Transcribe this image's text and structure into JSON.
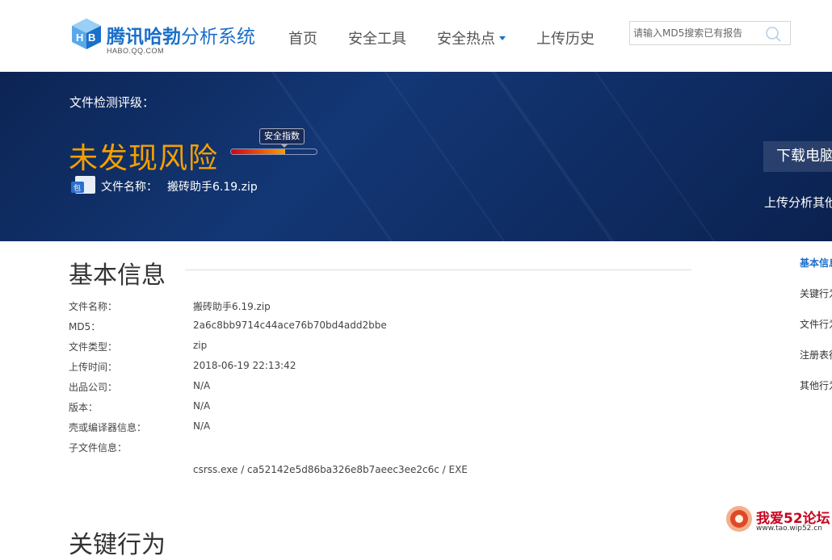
{
  "header": {
    "logo_title_strong": "腾讯哈勃",
    "logo_title_rest": "分析系统",
    "logo_sub": "HABO.QQ.COM",
    "nav": [
      {
        "label": "首页"
      },
      {
        "label": "安全工具"
      },
      {
        "label": "安全热点",
        "has_dropdown": true
      },
      {
        "label": "上传历史"
      }
    ],
    "search_placeholder": "请输入MD5搜索已有报告",
    "search_icon": "search-icon"
  },
  "banner": {
    "rating_label": "文件检测评级：",
    "risk_text": "未发现风险",
    "index_badge": "安全指数",
    "meter_fraction": 0.63,
    "file_icon_text": "包",
    "file_name_label": "文件名称：",
    "file_name": "搬砖助手6.19.zip",
    "download_button": "下载电脑",
    "upload_other": "上传分析其他"
  },
  "basic_info": {
    "title": "基本信息",
    "rows": [
      {
        "label": "文件名称：",
        "value": "搬砖助手6.19.zip"
      },
      {
        "label": "MD5：",
        "value": "2a6c8bb9714c44ace76b70bd4add2bbe"
      },
      {
        "label": "文件类型：",
        "value": "zip"
      },
      {
        "label": "上传时间：",
        "value": "2018-06-19 22:13:42"
      },
      {
        "label": "出品公司：",
        "value": "N/A"
      },
      {
        "label": "版本：",
        "value": "N/A"
      },
      {
        "label": "壳或编译器信息：",
        "value": "N/A"
      },
      {
        "label": "子文件信息：",
        "value": ""
      }
    ],
    "subfile": "csrss.exe /  ca52142e5d86ba326e8b7aeec3ee2c6c /  EXE"
  },
  "next_section_title": "关键行为",
  "side_nav": [
    {
      "label": "基本信息",
      "active": true
    },
    {
      "label": "关键行为"
    },
    {
      "label": "文件行为"
    },
    {
      "label": "注册表行"
    },
    {
      "label": "其他行为"
    }
  ],
  "watermark": {
    "text": "我爱52论坛",
    "url": "www.tao.wip52.cn"
  },
  "colors": {
    "brand_blue": "#1a6fc9",
    "banner_bg": "#133775",
    "risk_orange": "#f5a000"
  }
}
